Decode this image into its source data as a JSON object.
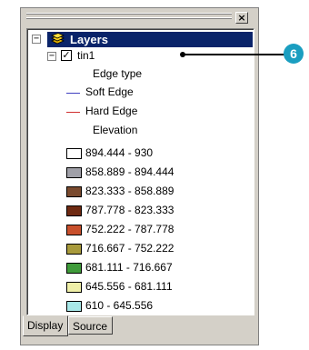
{
  "toc": {
    "close_symbol": "×",
    "root": {
      "expander": "−",
      "label": "Layers"
    },
    "layer": {
      "expander": "−",
      "checked_symbol": "✓",
      "name": "tin1",
      "edge_heading": "Edge type",
      "edges": [
        {
          "label": "Soft Edge",
          "color": "#4040c0"
        },
        {
          "label": "Hard Edge",
          "color": "#d03030"
        }
      ],
      "elevation_heading": "Elevation",
      "classes": [
        {
          "label": "894.444 - 930",
          "color": "#ffffff"
        },
        {
          "label": "858.889 - 894.444",
          "color": "#a0a0a8"
        },
        {
          "label": "823.333 - 858.889",
          "color": "#7a4a2e"
        },
        {
          "label": "787.778 - 823.333",
          "color": "#6e2a12"
        },
        {
          "label": "752.222 - 787.778",
          "color": "#c8502c"
        },
        {
          "label": "716.667 - 752.222",
          "color": "#a89a3c"
        },
        {
          "label": "681.111 - 716.667",
          "color": "#3f9b3a"
        },
        {
          "label": "645.556 - 681.111",
          "color": "#f0f0a8"
        },
        {
          "label": "610 - 645.556",
          "color": "#a8e8e8"
        }
      ]
    },
    "tabs": [
      "Display",
      "Source"
    ]
  },
  "callout": {
    "number": "6",
    "color": "#1a9ec0"
  }
}
